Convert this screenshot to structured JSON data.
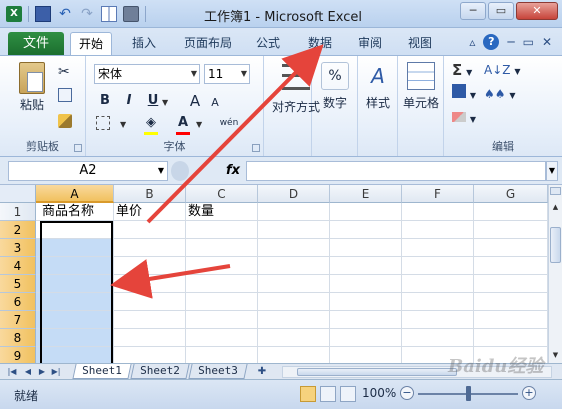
{
  "window": {
    "title": "工作簿1 - Microsoft Excel",
    "minimize_icon": "minimize-icon",
    "restore_icon": "restore-icon",
    "close_icon": "close-icon",
    "restore_label": "▭",
    "minimize_label": "─",
    "close_label": "✕"
  },
  "quick_access": {
    "excel_logo": "X",
    "undo_label": "↶",
    "redo_label": "↷"
  },
  "tabs": {
    "file": "文件",
    "items": [
      "开始",
      "插入",
      "页面布局",
      "公式",
      "数据",
      "审阅",
      "视图"
    ],
    "active": "开始",
    "help_label": "?",
    "caret_label": "▵"
  },
  "ribbon": {
    "clipboard": {
      "label": "剪贴板",
      "paste": "粘贴"
    },
    "font": {
      "label": "字体",
      "name": "宋体",
      "size": "11",
      "bold": "B",
      "italic": "I",
      "underline": "U",
      "grow": "A",
      "shrink": "A",
      "fill_color_hex": "#ffff00",
      "font_color_hex": "#ff0000",
      "font_color_label": "A",
      "phonetic": "wén"
    },
    "alignment": {
      "label": "对齐方式"
    },
    "number": {
      "label": "数字",
      "icon_label": "%"
    },
    "styles": {
      "label": "样式",
      "icon_label": "A"
    },
    "cells": {
      "label": "单元格"
    },
    "editing": {
      "label": "编辑",
      "sum_label": "Σ",
      "sort_label": "A↓Z",
      "find_label": "🔍"
    }
  },
  "formula_bar": {
    "name_box": "A2",
    "fx": "fx",
    "value": ""
  },
  "sheet": {
    "columns": [
      "A",
      "B",
      "C",
      "D",
      "E",
      "F",
      "G"
    ],
    "rows": [
      "1",
      "2",
      "3",
      "4",
      "5",
      "6",
      "7",
      "8",
      "9"
    ],
    "cells": {
      "A1": "商品名称",
      "B1": "单价",
      "C1": "数量"
    },
    "selected_range": "A2:A9",
    "active_cell": "A2",
    "selection_color_hex": "#c5dcf6"
  },
  "sheet_tabs": {
    "items": [
      "Sheet1",
      "Sheet2",
      "Sheet3"
    ],
    "active": "Sheet1"
  },
  "status_bar": {
    "status": "就绪",
    "zoom": "100%",
    "zoom_minus": "−",
    "zoom_plus": "+"
  },
  "annotations": {
    "arrow_color_hex": "#e5443b"
  },
  "watermark": "Baidu经验"
}
